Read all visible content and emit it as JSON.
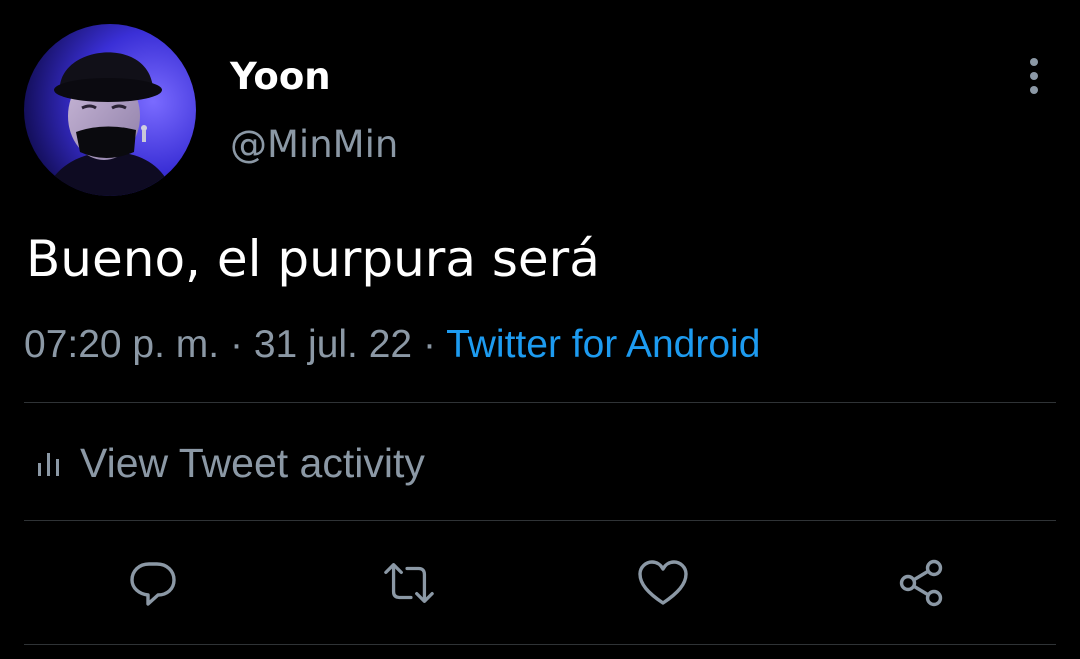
{
  "user": {
    "display_name": "Yoon",
    "handle": "@MinMin"
  },
  "tweet": {
    "text": "Bueno, el purpura será",
    "time": "07:20 p. m.",
    "separator": "·",
    "date": "31 jul. 22",
    "source": "Twitter for Android"
  },
  "activity": {
    "icon": "bar-chart-icon",
    "label": "View Tweet activity"
  },
  "actions": [
    {
      "name": "reply",
      "icon": "speech-bubble-icon"
    },
    {
      "name": "retweet",
      "icon": "retweet-arrows-icon"
    },
    {
      "name": "like",
      "icon": "heart-icon"
    },
    {
      "name": "share",
      "icon": "share-nodes-icon"
    }
  ],
  "colors": {
    "background": "#000000",
    "text_primary": "#ffffff",
    "text_secondary": "#8b98a5",
    "link": "#1d9bf0",
    "divider": "#2f3336"
  }
}
